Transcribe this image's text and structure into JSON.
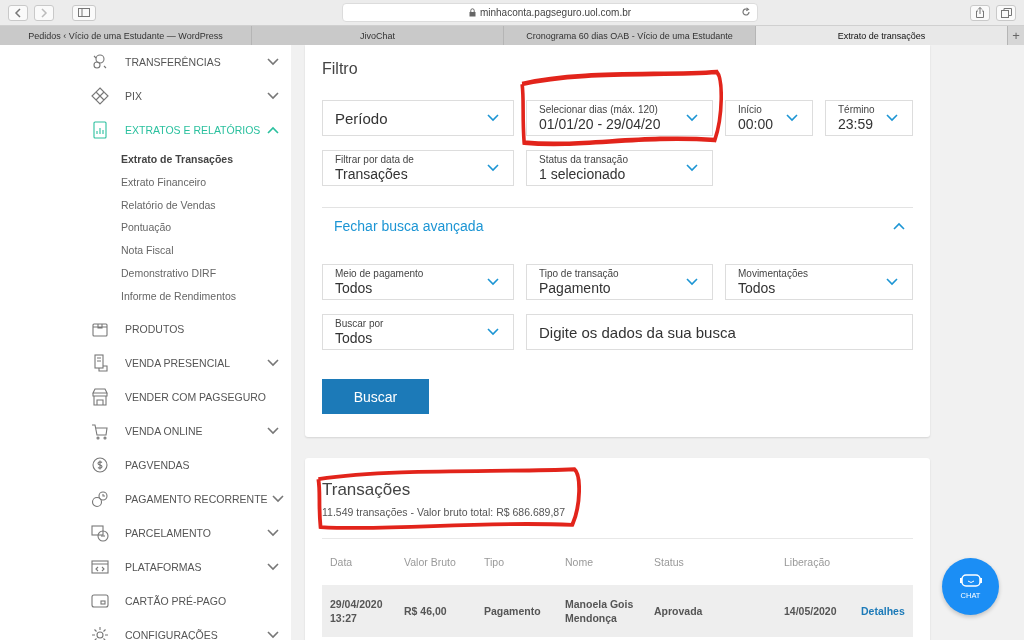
{
  "browser": {
    "url": "minhaconta.pagseguro.uol.com.br",
    "tabs": [
      {
        "title": "Pedidos ‹ Vício de uma Estudante — WordPress",
        "selected": false
      },
      {
        "title": "JivoChat",
        "selected": false
      },
      {
        "title": "Cronograma 60 dias OAB - Vício de uma Estudante",
        "selected": false
      },
      {
        "title": "Extrato de transações",
        "selected": true
      }
    ],
    "new_tab": "+"
  },
  "sidebar": {
    "items": [
      {
        "label": "TRANSFERÊNCIAS",
        "selected": false,
        "expanded": false
      },
      {
        "label": "PIX",
        "selected": false,
        "expanded": false
      },
      {
        "label": "EXTRATOS E RELATÓRIOS",
        "selected": true,
        "expanded": true,
        "children": [
          {
            "label": "Extrato de Transações",
            "selected": true
          },
          {
            "label": "Extrato Financeiro",
            "selected": false
          },
          {
            "label": "Relatório de Vendas",
            "selected": false
          },
          {
            "label": "Pontuação",
            "selected": false
          },
          {
            "label": "Nota Fiscal",
            "selected": false
          },
          {
            "label": "Demonstrativo DIRF",
            "selected": false
          },
          {
            "label": "Informe de Rendimentos",
            "selected": false
          }
        ]
      },
      {
        "label": "PRODUTOS",
        "selected": false
      },
      {
        "label": "VENDA PRESENCIAL",
        "selected": false,
        "expanded": false
      },
      {
        "label": "VENDER COM PAGSEGURO",
        "selected": false
      },
      {
        "label": "VENDA ONLINE",
        "selected": false,
        "expanded": false
      },
      {
        "label": "PAGVENDAS",
        "selected": false
      },
      {
        "label": "PAGAMENTO RECORRENTE",
        "selected": false,
        "expanded": false
      },
      {
        "label": "PARCELAMENTO",
        "selected": false,
        "expanded": false
      },
      {
        "label": "PLATAFORMAS",
        "selected": false,
        "expanded": false
      },
      {
        "label": "CARTÃO PRÉ-PAGO",
        "selected": false
      },
      {
        "label": "CONFIGURAÇÕES",
        "selected": false,
        "expanded": false
      }
    ]
  },
  "filter": {
    "title": "Filtro",
    "fields": [
      {
        "kind": "select",
        "value": "Período",
        "highlighted": false
      },
      {
        "kind": "select",
        "label": "Selecionar dias (máx. 120)",
        "value": "01/01/20 - 29/04/20",
        "highlighted": true
      },
      {
        "kind": "select",
        "label": "Início",
        "value": "00:00",
        "highlighted": false
      },
      {
        "kind": "select",
        "label": "Término",
        "value": "23:59",
        "highlighted": false
      },
      {
        "kind": "select",
        "label": "Filtrar por data de",
        "value": "Transações",
        "highlighted": false
      },
      {
        "kind": "select",
        "label": "Status da transação",
        "value": "1 selecionado",
        "highlighted": false
      }
    ],
    "advanced": {
      "label": "Fechar busca avançada",
      "expanded": true,
      "fields": [
        {
          "kind": "select",
          "label": "Meio de pagamento",
          "value": "Todos"
        },
        {
          "kind": "select",
          "label": "Tipo de transação",
          "value": "Pagamento"
        },
        {
          "kind": "select",
          "label": "Movimentações",
          "value": "Todos"
        },
        {
          "kind": "select",
          "label": "Buscar por",
          "value": "Todos"
        },
        {
          "kind": "input",
          "placeholder": "Digite os dados da sua busca"
        }
      ]
    },
    "button": "Buscar"
  },
  "transactions": {
    "title": "Transações",
    "summary": "11.549 transações - Valor bruto total: R$ 686.689,87",
    "highlighted": true,
    "columns": [
      "Data",
      "Valor Bruto",
      "Tipo",
      "Nome",
      "Status",
      "Liberação"
    ],
    "rows": [
      {
        "cells": [
          "29/04/2020 13:27",
          "R$ 46,00",
          "Pagamento",
          "Manoela Gois Mendonça",
          "Aprovada",
          "14/05/2020"
        ],
        "action": "Detalhes"
      }
    ]
  },
  "chat": {
    "label": "CHAT"
  }
}
